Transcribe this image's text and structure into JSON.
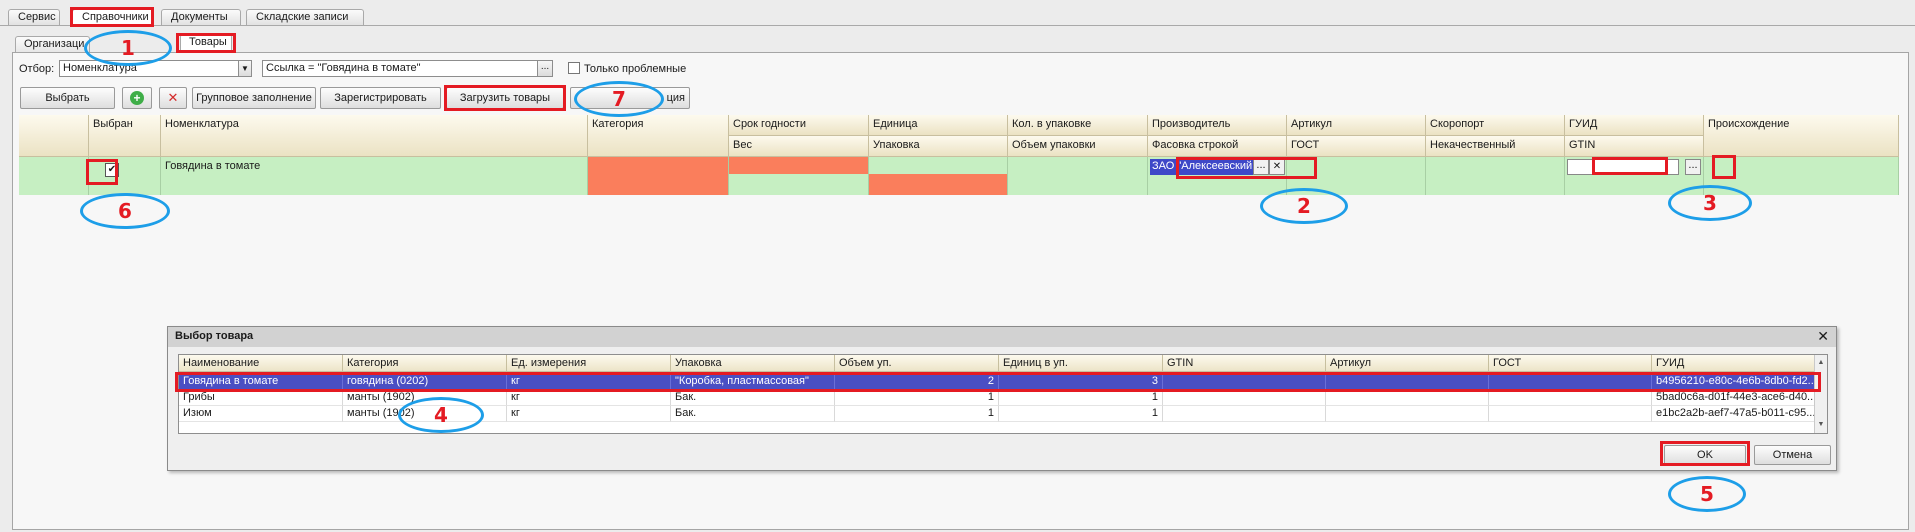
{
  "top_tabs": [
    "Сервис",
    "Справочники",
    "Документы",
    "Складские записи"
  ],
  "sub_tabs": [
    "Организаци",
    "Товары"
  ],
  "filter": {
    "label": "Отбор:",
    "field_value": "Номенклатура",
    "condition_value": "Ссылка = \"Говядина в томате\"",
    "ellipsis": "...",
    "only_problem_label": "Только проблемные"
  },
  "toolbar": {
    "select": "Выбрать",
    "group_fill": "Групповое заполнение",
    "register": "Зарегистрировать",
    "load_goods": "Загрузить товары",
    "hidden_button_tail": "ция"
  },
  "grid": {
    "headers_row1": [
      "Выбран",
      "Номенклатура",
      "Категория",
      "Срок годности",
      "Единица",
      "Кол. в упаковке",
      "Производитель",
      "Артикул",
      "Скоропорт",
      "ГУИД",
      "Происхождение"
    ],
    "headers_row2": [
      "Вес",
      "Упаковка",
      "Объем упаковки",
      "Фасовка строкой",
      "ГОСТ",
      "Некачественный",
      "GTIN"
    ],
    "row": {
      "checked": true,
      "checkmark": "✔",
      "name": "Говядина в томате",
      "producer": "ЗАО \"Алексеевский",
      "producer_btn": "...",
      "producer_clear": "✕",
      "guid_btn": "..."
    }
  },
  "dialog": {
    "title": "Выбор товара",
    "close": "✕",
    "headers": [
      "Наименование",
      "Категория",
      "Ед. измерения",
      "Упаковка",
      "Объем уп.",
      "Единиц в уп.",
      "GTIN",
      "Артикул",
      "ГОСТ",
      "ГУИД"
    ],
    "rows": [
      [
        "Говядина в томате",
        "говядина (0202)",
        "кг",
        "\"Коробка, пластмассовая\"",
        "2",
        "3",
        "",
        "",
        "",
        "b4956210-e80c-4e6b-8db0-fd2..."
      ],
      [
        "Грибы",
        "манты (1902)",
        "кг",
        "Бак.",
        "1",
        "1",
        "",
        "",
        "",
        "5bad0c6a-d01f-44e3-ace6-d40..."
      ],
      [
        "Изюм",
        "манты (1902)",
        "кг",
        "Бак.",
        "1",
        "1",
        "",
        "",
        "",
        "e1bc2a2b-aef7-47a5-b011-c95..."
      ]
    ],
    "ok": "OK",
    "cancel": "Отмена"
  },
  "callouts": [
    "1",
    "2",
    "3",
    "4",
    "5",
    "6",
    "7"
  ],
  "colors": {
    "highlight_red": "#e41b23",
    "callout_blue": "#1d9ee8",
    "row_green": "#c6efc2",
    "required_orange": "#fa7e5c",
    "selection_blue": "#4a4fc3"
  }
}
